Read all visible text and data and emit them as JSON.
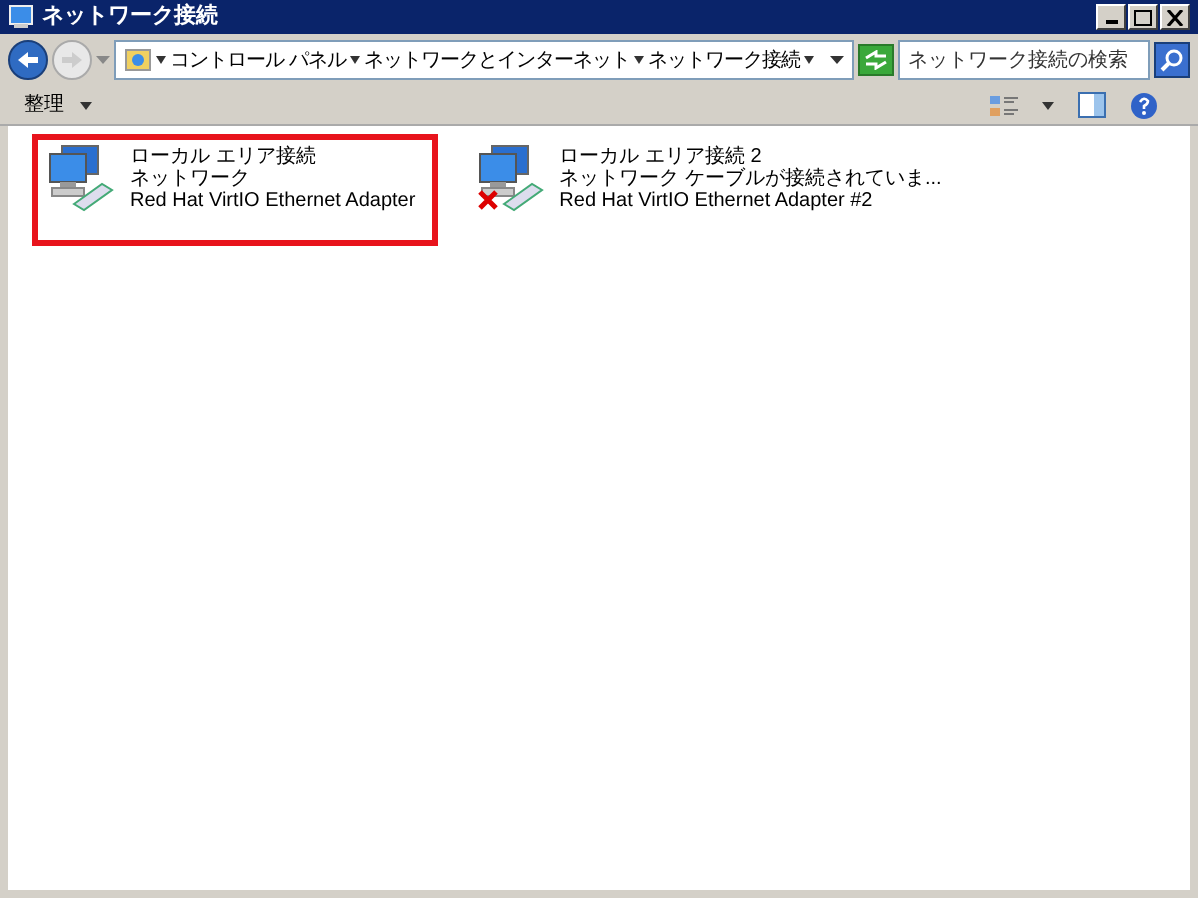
{
  "window": {
    "title": "ネットワーク接続"
  },
  "address_bar": {
    "breadcrumbs": [
      "コントロール パネル",
      "ネットワークとインターネット",
      "ネットワーク接続"
    ]
  },
  "search": {
    "placeholder": "ネットワーク接続の検索"
  },
  "toolbar": {
    "organize": "整理"
  },
  "connections": [
    {
      "name": "ローカル エリア接続",
      "status": "ネットワーク",
      "adapter": "Red Hat VirtIO Ethernet Adapter",
      "disconnected": false,
      "highlighted": true
    },
    {
      "name": "ローカル エリア接続 2",
      "status": "ネットワーク ケーブルが接続されていま...",
      "adapter": "Red Hat VirtIO Ethernet Adapter #2",
      "disconnected": true,
      "highlighted": false
    }
  ]
}
